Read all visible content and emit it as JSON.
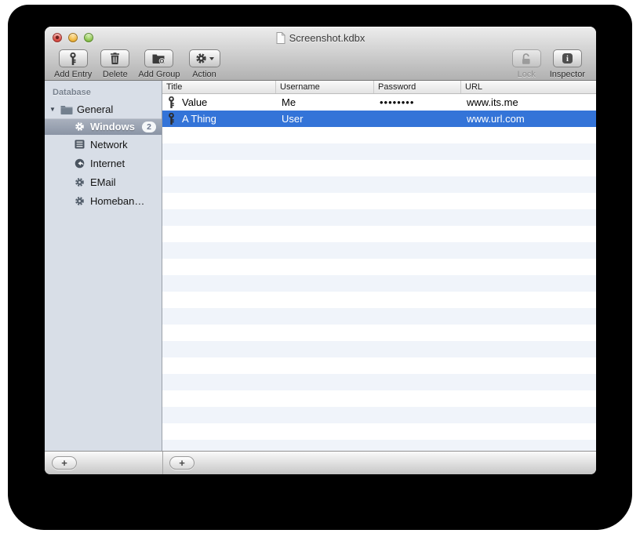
{
  "window": {
    "title": "Screenshot.kdbx"
  },
  "toolbar": {
    "add_entry_label": "Add Entry",
    "delete_label": "Delete",
    "add_group_label": "Add Group",
    "action_label": "Action",
    "lock_label": "Lock",
    "inspector_label": "Inspector"
  },
  "sidebar": {
    "header": "Database",
    "root_group": {
      "label": "General",
      "icon": "folder-icon",
      "expanded": true
    },
    "groups": [
      {
        "label": "Windows",
        "badge": "2",
        "icon": "gear-icon",
        "selected": true
      },
      {
        "label": "Network",
        "icon": "network-icon",
        "selected": false
      },
      {
        "label": "Internet",
        "icon": "globe-icon",
        "selected": false
      },
      {
        "label": "EMail",
        "icon": "gear-icon",
        "selected": false
      },
      {
        "label": "Homeban…",
        "icon": "gear-icon",
        "selected": false
      }
    ]
  },
  "table": {
    "columns": [
      "Title",
      "Username",
      "Password",
      "URL"
    ],
    "rows": [
      {
        "icon": "key-icon",
        "title": "Value",
        "username": "Me",
        "password": "••••••••",
        "url": "www.its.me",
        "selected": false
      },
      {
        "icon": "key-icon",
        "title": "A Thing",
        "username": "User",
        "password": "",
        "url": "www.url.com",
        "selected": true
      }
    ]
  },
  "bottombar": {
    "add_group_button": "+",
    "add_entry_button": "+"
  },
  "icons": {
    "disclosure": "▼"
  },
  "colors": {
    "selection_blue": "#3474D8",
    "row_stripe": "#F0F4FA",
    "sidebar_background": "#D8DEE7",
    "sidebar_selection": "#8C96A6"
  }
}
